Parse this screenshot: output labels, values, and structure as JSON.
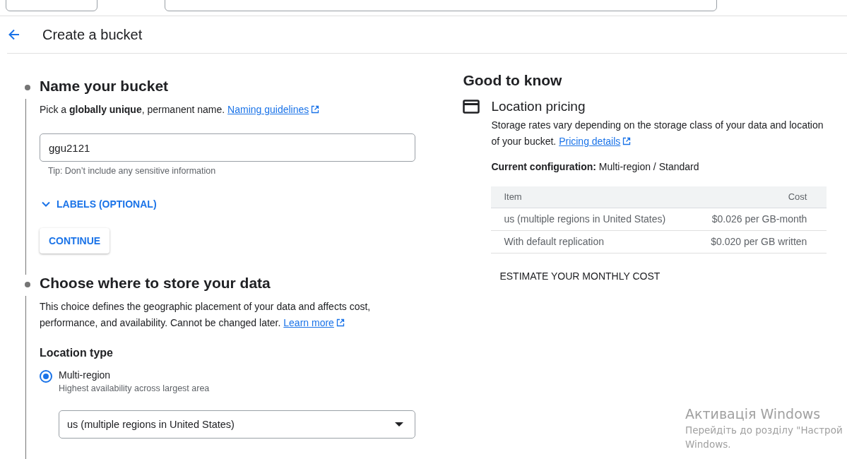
{
  "header": {
    "title": "Create a bucket"
  },
  "steps": [
    {
      "kind": "name",
      "title": "Name your bucket",
      "description": "Pick a **globally unique**, permanent name.",
      "link": "Naming guidelines",
      "field": {
        "value": "ggu2121",
        "hint": "Tip: Don’t include any sensitive information"
      },
      "expander": {
        "label": "LABELS (OPTIONAL)",
        "expanded": false
      },
      "button": "CONTINUE"
    },
    {
      "kind": "location",
      "title": "Choose where to store your data",
      "description": "This choice defines the geographic placement of your data and affects cost, performance, and availability. Cannot be changed later.",
      "link": "Learn more",
      "subtitle": "Location type",
      "options": [
        {
          "label": "Multi-region",
          "hint": "Highest availability across largest area",
          "selected": true
        }
      ],
      "dropdown": "us (multiple regions in United States)"
    }
  ],
  "good_to_know": {
    "title": "Good to know",
    "section": "Location pricing",
    "description": "Storage rates vary depending on the storage class of your data and location of your bucket.",
    "link": "Pricing details",
    "config_label": "Current configuration:",
    "config_value": "Multi-region / Standard",
    "table": {
      "columns": [
        "Item",
        "Cost"
      ],
      "rows": [
        [
          "us (multiple regions in United States)",
          "$0.026 per GB-month"
        ],
        [
          "With default replication",
          "$0.020 per GB written"
        ]
      ]
    },
    "button": "ESTIMATE YOUR MONTHLY COST"
  },
  "os_notice": {
    "title": "Активація Windows",
    "text": "Перейдіть до розділу \"Настрой",
    "text_2": "Windows."
  }
}
